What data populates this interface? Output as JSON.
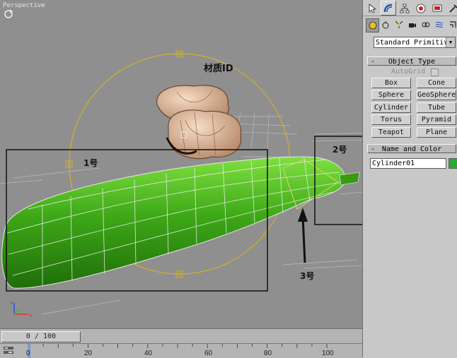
{
  "viewport": {
    "label": "Perspective",
    "annotations": {
      "material_id": "材质ID",
      "box1": "1号",
      "box2": "2号",
      "box3": "3号"
    }
  },
  "timeline": {
    "frame_readout": "0 / 100",
    "ticks": [
      "0",
      "20",
      "40",
      "60",
      "80",
      "100"
    ]
  },
  "command_panel": {
    "tabs": [
      "select-icon",
      "create-icon",
      "hierarchy-icon",
      "motion-icon",
      "display-icon",
      "utilities-icon"
    ],
    "subtabs": [
      "geometry-icon",
      "shapes-icon",
      "lights-icon",
      "cameras-icon",
      "helpers-icon",
      "spacewarps-icon",
      "systems-icon"
    ],
    "category_dropdown": "Standard Primitiv",
    "object_type": {
      "header": "Object Type",
      "sign": "-",
      "autogrid_label": "AutoGrid",
      "buttons": [
        "Box",
        "Cone",
        "Sphere",
        "GeoSphere",
        "Cylinder",
        "Tube",
        "Torus",
        "Pyramid",
        "Teapot",
        "Plane"
      ]
    },
    "name_and_color": {
      "header": "Name and Color",
      "sign": "-",
      "name_value": "Cylinder01",
      "color": "#2fa82f"
    }
  }
}
